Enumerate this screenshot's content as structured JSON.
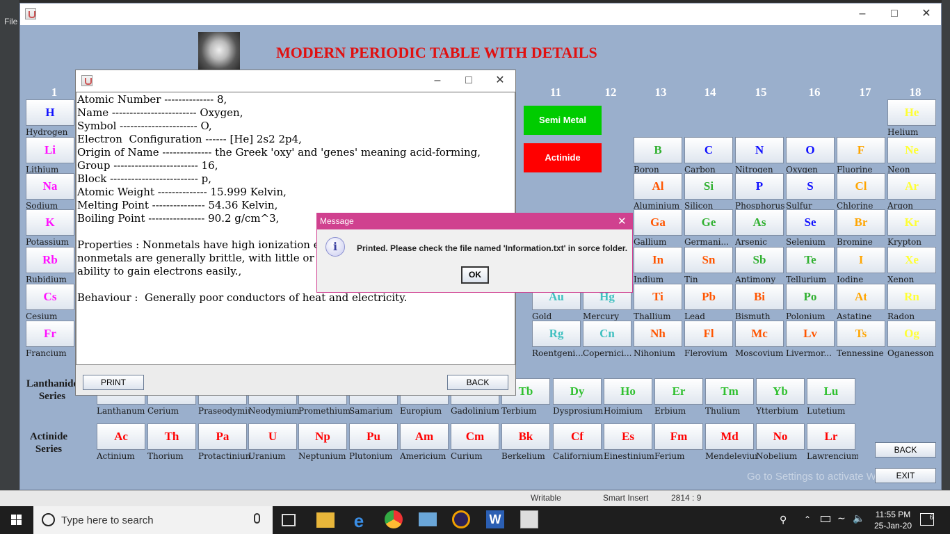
{
  "ide": {
    "file_menu": "File",
    "status": {
      "writable": "Writable",
      "insert": "Smart Insert",
      "position": "2814 : 9"
    }
  },
  "main": {
    "title": "MODERN PERIODIC TABLE WITH DETAILS",
    "groups": [
      "1",
      "11",
      "12",
      "13",
      "14",
      "15",
      "16",
      "17",
      "18"
    ],
    "categories": {
      "semi_metal": "Semi Metal",
      "actinide": "Actinide"
    },
    "series": {
      "lanthanide": "Lanthanide Series",
      "actinide": "Actinide Series"
    },
    "back_button": "BACK",
    "exit_button": "EXIT",
    "watermark": "Go to Settings to activate Windows."
  },
  "colors": {
    "background": "#9aafcc",
    "title": "#e01010",
    "semi_metal": "#00cc00",
    "actinide": "#ff0000",
    "dialog_title": "#d0418f"
  },
  "elements": [
    {
      "s": "H",
      "n": "Hydrogen",
      "c": "#1010ff"
    },
    {
      "s": "He",
      "n": "Helium",
      "c": "#ffff33"
    },
    {
      "s": "Li",
      "n": "Lithium",
      "c": "#ff10ff"
    },
    {
      "s": "B",
      "n": "Boron",
      "c": "#30b030"
    },
    {
      "s": "C",
      "n": "Carbon",
      "c": "#1010ff"
    },
    {
      "s": "N",
      "n": "Nitrogen",
      "c": "#1010ff"
    },
    {
      "s": "O",
      "n": "Oxygen",
      "c": "#1010ff"
    },
    {
      "s": "F",
      "n": "Fluorine",
      "c": "#ffa500"
    },
    {
      "s": "Ne",
      "n": "Neon",
      "c": "#ffff33"
    },
    {
      "s": "Na",
      "n": "Sodium",
      "c": "#ff10ff"
    },
    {
      "s": "Al",
      "n": "Aluminium",
      "c": "#ff5500"
    },
    {
      "s": "Si",
      "n": "Silicon",
      "c": "#30b030"
    },
    {
      "s": "P",
      "n": "Phosphorus",
      "c": "#1010ff"
    },
    {
      "s": "S",
      "n": "Sulfur",
      "c": "#1010ff"
    },
    {
      "s": "Cl",
      "n": "Chlorine",
      "c": "#ffa500"
    },
    {
      "s": "Ar",
      "n": "Argon",
      "c": "#ffff33"
    },
    {
      "s": "K",
      "n": "Potassium",
      "c": "#ff10ff"
    },
    {
      "s": "Ga",
      "n": "Gallium",
      "c": "#ff5500"
    },
    {
      "s": "Ge",
      "n": "Germani...",
      "c": "#30b030"
    },
    {
      "s": "As",
      "n": "Arsenic",
      "c": "#30b030"
    },
    {
      "s": "Se",
      "n": "Selenium",
      "c": "#1010ff"
    },
    {
      "s": "Br",
      "n": "Bromine",
      "c": "#ffa500"
    },
    {
      "s": "Kr",
      "n": "Krypton",
      "c": "#ffff33"
    },
    {
      "s": "Rb",
      "n": "Rubidium",
      "c": "#ff10ff"
    },
    {
      "s": "In",
      "n": "Indium",
      "c": "#ff5500"
    },
    {
      "s": "Sn",
      "n": "Tin",
      "c": "#ff5500"
    },
    {
      "s": "Sb",
      "n": "Antimony",
      "c": "#30b030"
    },
    {
      "s": "Te",
      "n": "Tellurium",
      "c": "#30b030"
    },
    {
      "s": "I",
      "n": "Iodine",
      "c": "#ffa500"
    },
    {
      "s": "Xe",
      "n": "Xenon",
      "c": "#ffff33"
    },
    {
      "s": "Cs",
      "n": "Cesium",
      "c": "#ff10ff"
    },
    {
      "s": "Au",
      "n": "Gold",
      "c": "#40c0c0"
    },
    {
      "s": "Hg",
      "n": "Mercury",
      "c": "#40c0c0"
    },
    {
      "s": "Ti",
      "n": "Thallium",
      "c": "#ff5500"
    },
    {
      "s": "Pb",
      "n": "Lead",
      "c": "#ff5500"
    },
    {
      "s": "Bi",
      "n": "Bismuth",
      "c": "#ff5500"
    },
    {
      "s": "Po",
      "n": "Polonium",
      "c": "#30b030"
    },
    {
      "s": "At",
      "n": "Astatine",
      "c": "#ffa500"
    },
    {
      "s": "Rn",
      "n": "Radon",
      "c": "#ffff33"
    },
    {
      "s": "Fr",
      "n": "Francium",
      "c": "#ff10ff"
    },
    {
      "s": "Rg",
      "n": "Roentgeni...",
      "c": "#40c0c0"
    },
    {
      "s": "Cn",
      "n": "Copernici...",
      "c": "#40c0c0"
    },
    {
      "s": "Nh",
      "n": "Nihonium",
      "c": "#ff5500"
    },
    {
      "s": "Fl",
      "n": "Flerovium",
      "c": "#ff5500"
    },
    {
      "s": "Mc",
      "n": "Moscovium",
      "c": "#ff5500"
    },
    {
      "s": "Lv",
      "n": "Livermor...",
      "c": "#ff5500"
    },
    {
      "s": "Ts",
      "n": "Tennessine",
      "c": "#ffa500"
    },
    {
      "s": "Og",
      "n": "Oganesson",
      "c": "#ffff33"
    }
  ],
  "lanthanides": [
    {
      "s": "",
      "n": "Lanthanum"
    },
    {
      "s": "",
      "n": "Cerium"
    },
    {
      "s": "",
      "n": "Praseodymium"
    },
    {
      "s": "",
      "n": "Neodymium"
    },
    {
      "s": "",
      "n": "Promethium"
    },
    {
      "s": "",
      "n": "Samarium"
    },
    {
      "s": "",
      "n": "Europium"
    },
    {
      "s": "",
      "n": "Gadolinium"
    },
    {
      "s": "Tb",
      "n": "Terbium"
    },
    {
      "s": "Dy",
      "n": "Dysprosium"
    },
    {
      "s": "Ho",
      "n": "Hoimium"
    },
    {
      "s": "Er",
      "n": "Erbium"
    },
    {
      "s": "Tm",
      "n": "Thulium"
    },
    {
      "s": "Yb",
      "n": "Ytterbium"
    },
    {
      "s": "Lu",
      "n": "Lutetium"
    }
  ],
  "actinides": [
    {
      "s": "Ac",
      "n": "Actinium"
    },
    {
      "s": "Th",
      "n": "Thorium"
    },
    {
      "s": "Pa",
      "n": "Protactinium"
    },
    {
      "s": "U",
      "n": "Uranium"
    },
    {
      "s": "Np",
      "n": "Neptunium"
    },
    {
      "s": "Pu",
      "n": "Plutonium"
    },
    {
      "s": "Am",
      "n": "Americium"
    },
    {
      "s": "Cm",
      "n": "Curium"
    },
    {
      "s": "Bk",
      "n": "Berkelium"
    },
    {
      "s": "Cf",
      "n": "Californium"
    },
    {
      "s": "Es",
      "n": "Einestinium"
    },
    {
      "s": "Fm",
      "n": "Ferium"
    },
    {
      "s": "Md",
      "n": "Mendelevium"
    },
    {
      "s": "No",
      "n": "Nobelium"
    },
    {
      "s": "Lr",
      "n": "Lawrencium"
    }
  ],
  "detail": {
    "lines": [
      "Atomic Number -------------- 8,",
      "Name ------------------------ Oxygen,",
      "Symbol ---------------------- O,",
      "Electron  Configuration ------ [He] 2s2 2p4,",
      "Origin of Name -------------- the Greek 'oxy' and 'genes' meaning acid-forming,",
      "Group ------------------------ 16,",
      "Block ------------------------- p,",
      "Atomic Weight -------------- 15.999 Kelvin,",
      "Melting Point --------------- 54.36 Kelvin,",
      "Boiling Point ---------------- 90.2 g/cm^3,",
      "",
      "Properties : Nonmetals have high ionization energ",
      "nonmetals are generally brittle, with little or no m",
      "ability to gain electrons easily.,",
      "",
      "Behaviour :  Generally poor conductors of heat and electricity."
    ],
    "print_button": "PRINT",
    "back_button": "BACK"
  },
  "message": {
    "title": "Message",
    "icon": "i",
    "text": "Printed. Please check the file named 'Information.txt' in sorce folder.",
    "ok": "OK"
  },
  "taskbar": {
    "search_placeholder": "Type here to search",
    "time": "11:55 PM",
    "date": "25-Jan-20",
    "notifications": "6"
  }
}
